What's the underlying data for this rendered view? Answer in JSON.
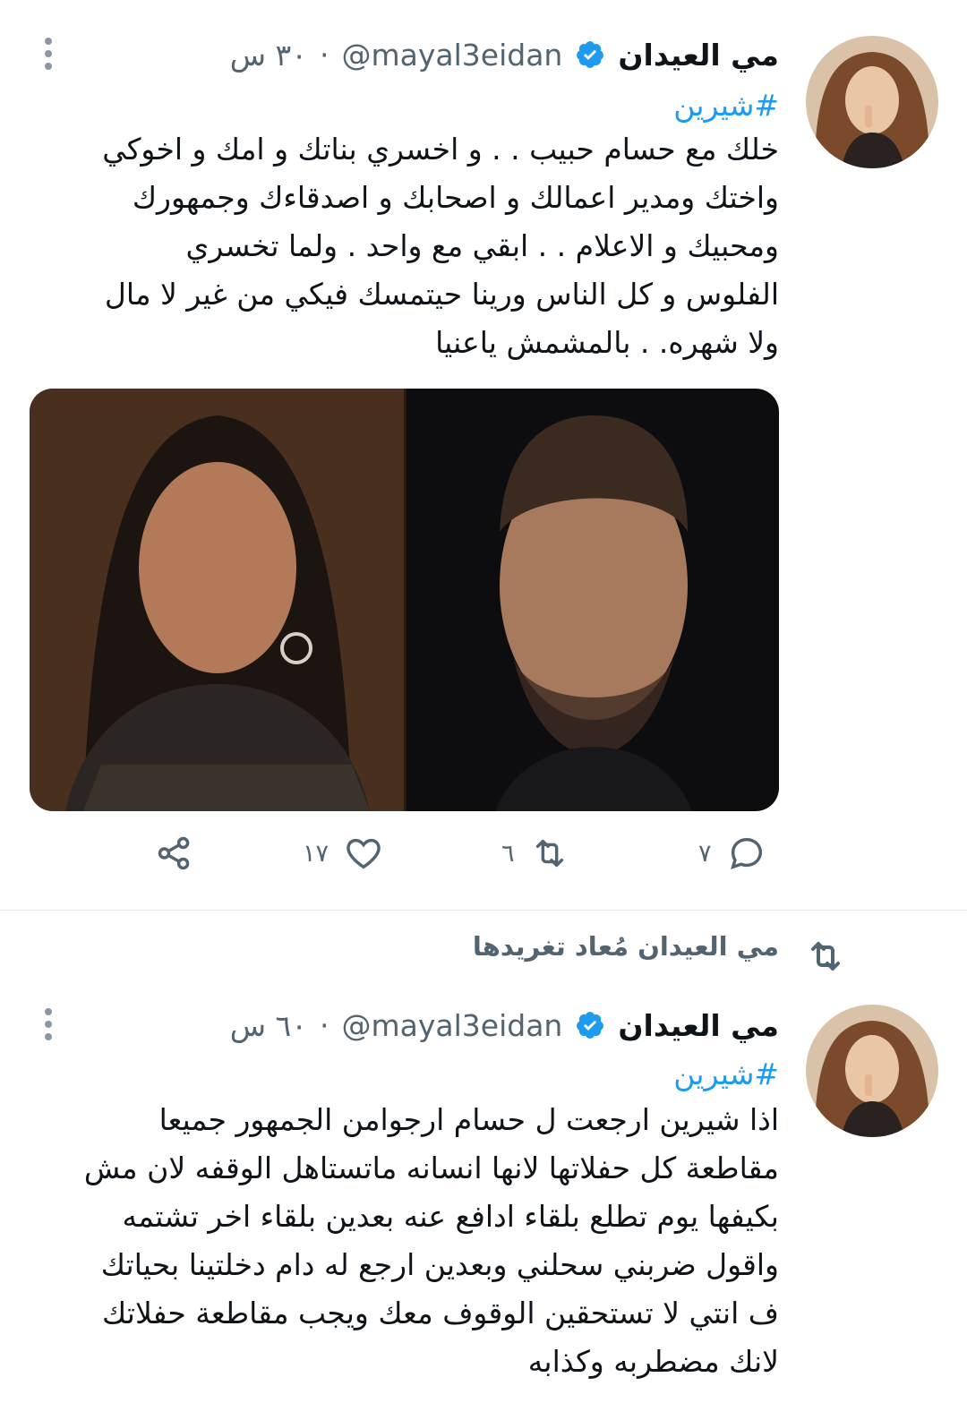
{
  "tweets": [
    {
      "author": {
        "name": "مي العيدان",
        "handle": "@mayal3eidan",
        "time": "٣٠ س"
      },
      "hashtag": "#شيرين",
      "text": "خلك مع حسام حبيب . . و اخسري بناتك و امك و اخوكي\nواختك ومدير اعمالك و اصحابك و اصدقاءك وجمهورك\nومحبيك و الاعلام . . ابقي مع واحد . ولما تخسري\nالفلوس و كل الناس ورينا حيتمسك فيكي من غير لا مال\nولا شهره. . بالمشمش ياعنيا",
      "actions": {
        "replies": "٧",
        "retweets": "٦",
        "likes": "١٧"
      }
    },
    {
      "retweet_context": "مي العيدان مُعاد تغريدها",
      "author": {
        "name": "مي العيدان",
        "handle": "@mayal3eidan",
        "time": "٦٠ س"
      },
      "hashtag": "#شيرين",
      "text": "اذا شيرين ارجعت ل حسام ارجوامن الجمهور جميعا\nمقاطعة كل حفلاتها لانها انسانه ماتستاهل الوقفه لان مش\nبكيفها يوم تطلع بلقاء ادافع عنه بعدين بلقاء اخر تشتمه\nواقول ضربني سحلني وبعدين ارجع له دام دخلتينا بحياتك\nف انتي لا تستحقين الوقوف معك ويجب مقاطعة حفلاتك\nلانك مضطربه وكذابه"
    }
  ],
  "colors": {
    "accent": "#1d9bf0",
    "secondary_text": "#536471",
    "text": "#0f1419"
  },
  "icons": [
    "verified-badge-icon",
    "more-options-icon",
    "reply-icon",
    "retweet-icon",
    "like-icon",
    "share-icon"
  ]
}
